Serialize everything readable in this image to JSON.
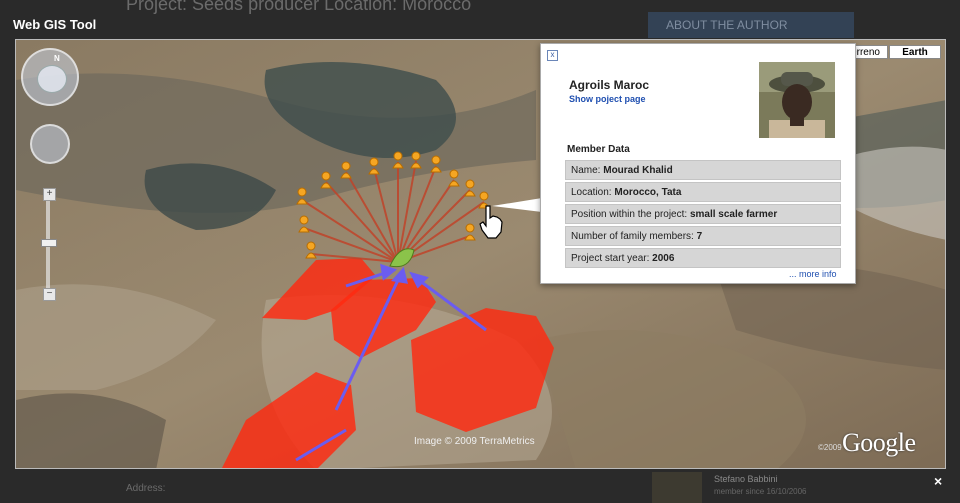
{
  "background_page": {
    "project_heading": "Project: Seeds producer  Location: Morocco",
    "sidebar_heading": "ABOUT THE AUTHOR",
    "address_label": "Address:",
    "member_card": {
      "name": "Stefano Babbini",
      "since": "member since 16/10/2006"
    }
  },
  "lightbox": {
    "title": "Web GIS Tool",
    "close_label": "×"
  },
  "map": {
    "compass_label": "N",
    "zoom_in_label": "+",
    "zoom_out_label": "−",
    "map_types": [
      "Terreno",
      "Earth"
    ],
    "active_map_type": "Earth",
    "attribution": "Image © 2009 TerraMetrics",
    "copyright_small": "©2009",
    "logo_text": "Google"
  },
  "info_window": {
    "close_label": "x",
    "organization": "Agroils Maroc",
    "project_link": "Show poject page",
    "section_title": "Member Data",
    "fields": [
      {
        "label": "Name:",
        "value": "Mourad Khalid"
      },
      {
        "label": "Location:",
        "value": "Morocco, Tata"
      },
      {
        "label": "Position within the project:",
        "value": "small scale farmer"
      },
      {
        "label": "Number of family members:",
        "value": "7"
      },
      {
        "label": "Project start year:",
        "value": "2006"
      }
    ],
    "more_info": "... more info"
  },
  "colors": {
    "field_overlay": "#ff2a10",
    "marker": "#f5a623",
    "spoke": "#c0442a",
    "arrow": "#6b5cf0",
    "link": "#1f4fb0"
  },
  "icons": [
    "compass-icon",
    "eye-icon",
    "pan-icon",
    "farmer-marker-icon",
    "leaf-icon",
    "hand-cursor-icon",
    "close-icon"
  ]
}
